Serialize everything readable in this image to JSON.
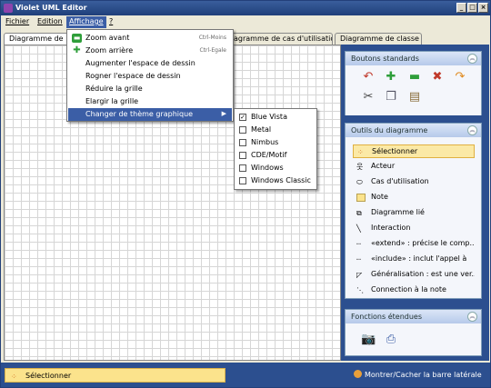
{
  "window": {
    "title": "Violet UML Editor",
    "controls": [
      "_",
      "□",
      "×"
    ]
  },
  "menubar": {
    "items": [
      "Fichier",
      "Edition",
      "Affichage",
      "?"
    ]
  },
  "tabs": [
    "Diagramme de",
    "agramme de cas d'utilisation",
    "Diagramme de classe"
  ],
  "affichage_menu": {
    "items": [
      {
        "label": "Zoom avant",
        "shortcut": "Ctrl-Moins"
      },
      {
        "label": "Zoom arrière",
        "shortcut": "Ctrl-Egale"
      },
      {
        "label": "Augmenter l'espace de dessin"
      },
      {
        "label": "Rogner l'espace de dessin"
      },
      {
        "label": "Réduire la grille"
      },
      {
        "label": "Elargir la grille"
      },
      {
        "label": "Changer de thème graphique"
      }
    ]
  },
  "theme_submenu": {
    "items": [
      {
        "label": "Blue Vista",
        "checked": true
      },
      {
        "label": "Metal",
        "checked": false
      },
      {
        "label": "Nimbus",
        "checked": false
      },
      {
        "label": "CDE/Motif",
        "checked": false
      },
      {
        "label": "Windows",
        "checked": false
      },
      {
        "label": "Windows Classic",
        "checked": false
      }
    ]
  },
  "panels": {
    "standard": {
      "title": "Boutons standards",
      "icons": [
        "undo-icon",
        "add-icon",
        "remove-icon",
        "delete-icon",
        "redo-icon",
        "cut-icon",
        "copy-icon",
        "paste-icon"
      ]
    },
    "tools": {
      "title": "Outils du diagramme",
      "items": [
        {
          "label": "Sélectionner",
          "icon": "select-icon"
        },
        {
          "label": "Acteur",
          "icon": "actor-icon"
        },
        {
          "label": "Cas d'utilisation",
          "icon": "usecase-icon"
        },
        {
          "label": "Note",
          "icon": "note-icon"
        },
        {
          "label": "Diagramme lié",
          "icon": "linked-diagram-icon"
        },
        {
          "label": "Interaction",
          "icon": "interaction-icon"
        },
        {
          "label": "«extend» : précise le comp...",
          "icon": "extend-icon"
        },
        {
          "label": "«include» : inclut l'appel à",
          "icon": "include-icon"
        },
        {
          "label": "Généralisation : est une ver...",
          "icon": "generalization-icon"
        },
        {
          "label": "Connection à la note",
          "icon": "note-connection-icon"
        }
      ]
    },
    "extended": {
      "title": "Fonctions étendues",
      "icons": [
        "camera-icon",
        "print-icon"
      ]
    }
  },
  "status": {
    "left": "Sélectionner",
    "right": "Montrer/Cacher la barre latérale"
  },
  "colors": {
    "accent": "#3b5ea6",
    "sidebar": "#2c4f8f",
    "selected_tool": "#fbe9a6"
  }
}
